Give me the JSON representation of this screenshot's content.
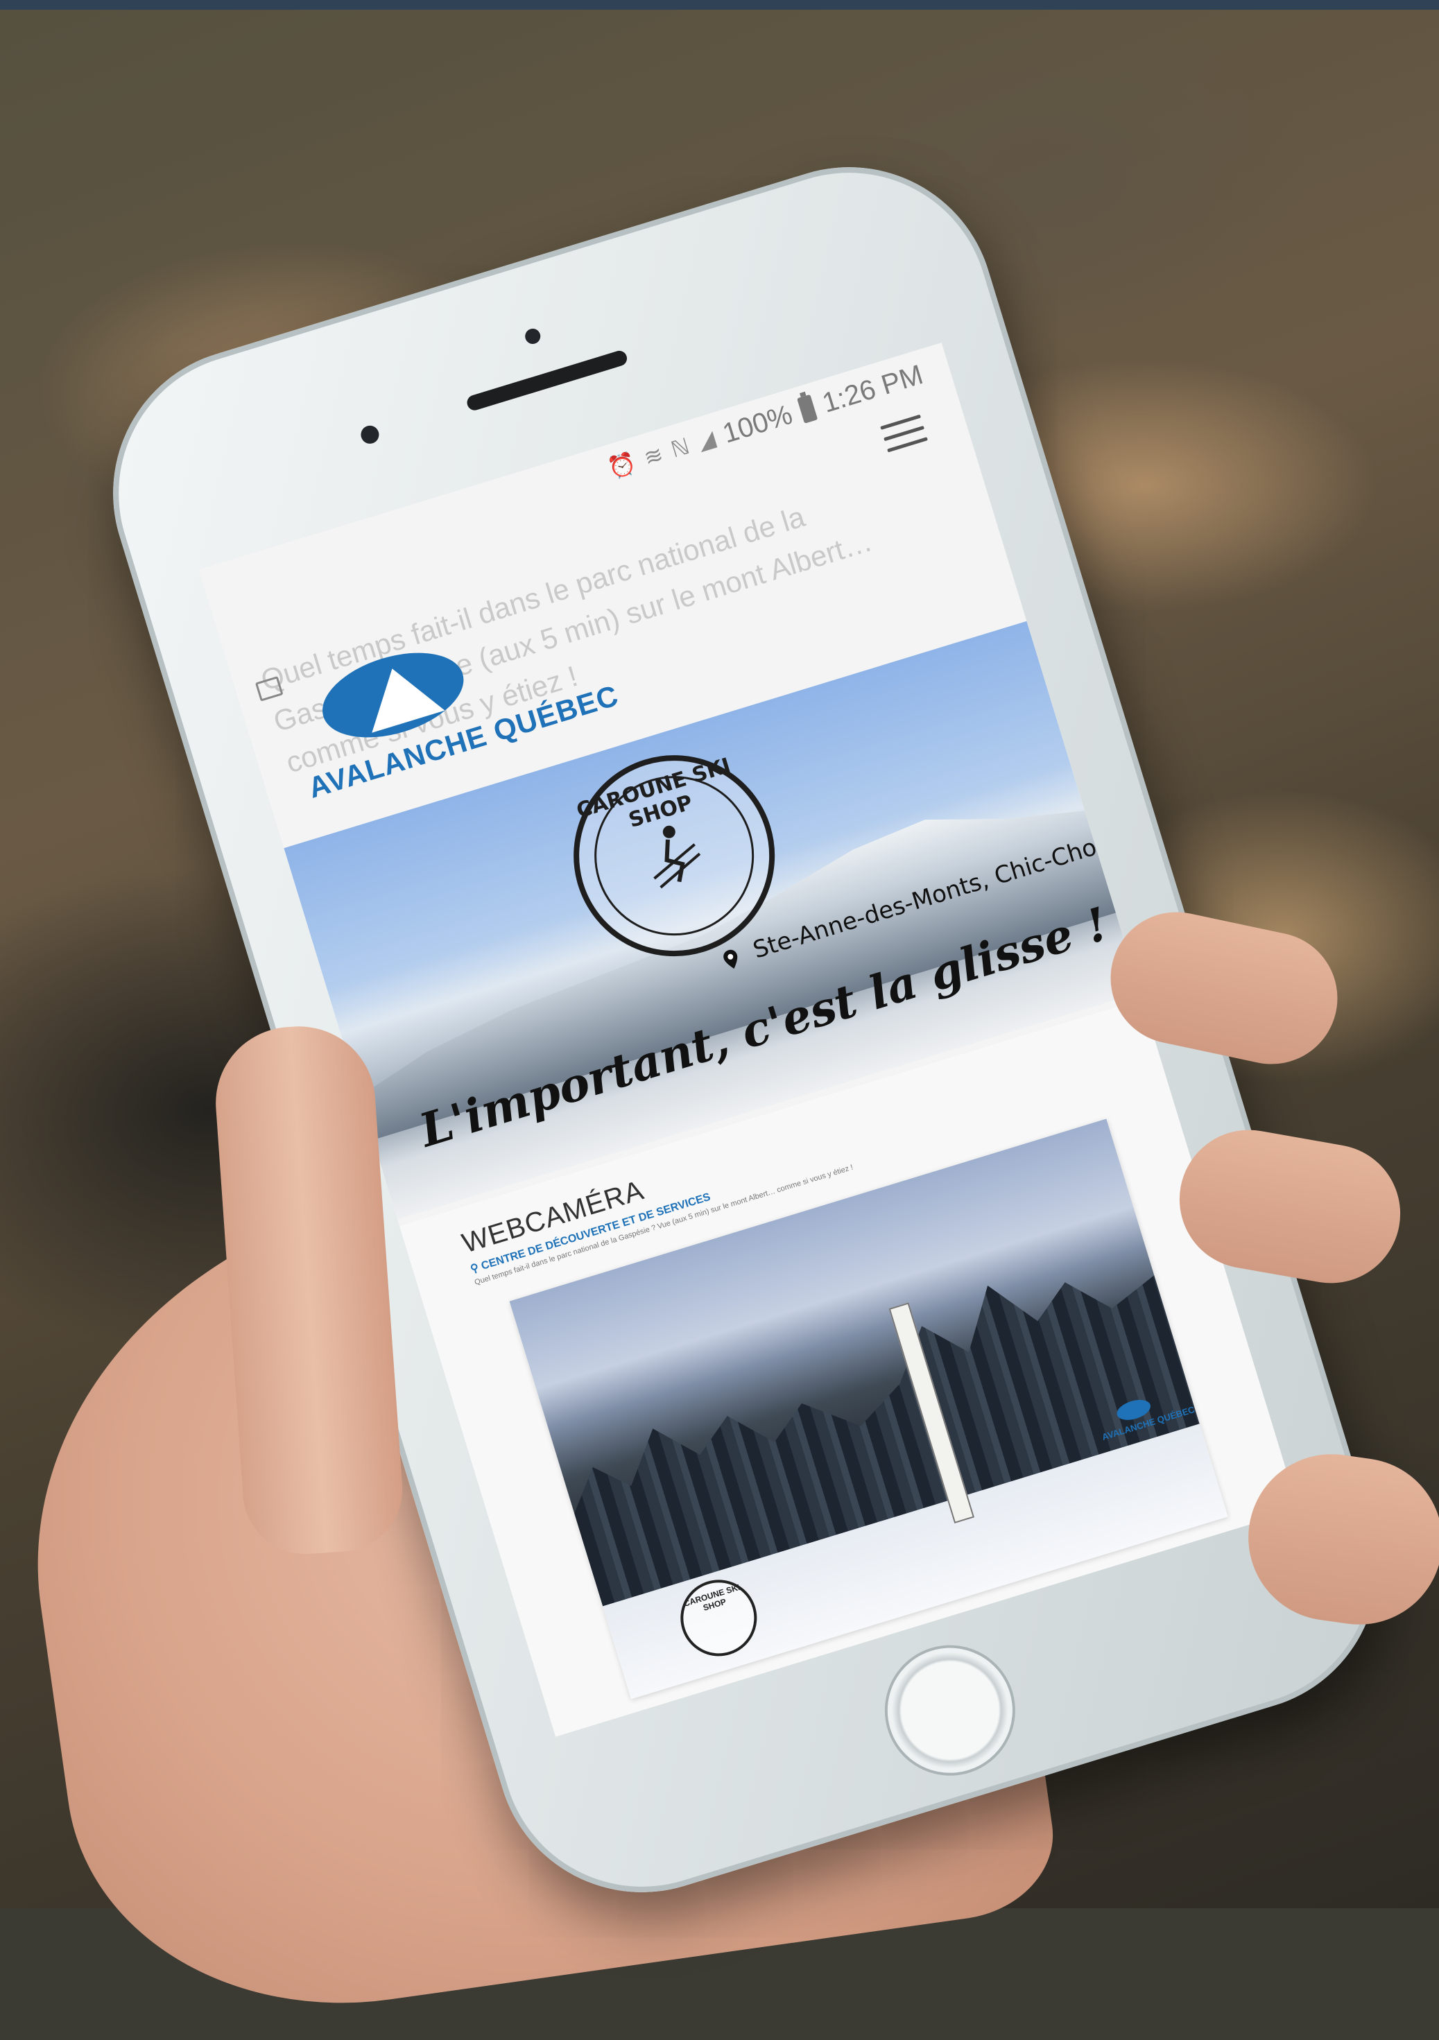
{
  "status_bar": {
    "battery_percent": "100%",
    "time": "1:26 PM",
    "icons": [
      "alarm-icon",
      "wifi-icon",
      "nfc-icon",
      "signal-icon",
      "battery-icon"
    ]
  },
  "header": {
    "menu_icon": "hamburger-menu-icon",
    "ghost_text": "Quel temps fait-il dans le parc national de la Gaspésie ? Vue (aux 5 min) sur le mont Albert… comme si vous y étiez !"
  },
  "logo": {
    "name": "AVALANCHE QUÉBEC",
    "color": "#1f72b8"
  },
  "hero": {
    "shop_name": "CAROUNE SKI SHOP",
    "tagline": "L'important, c'est la glisse !",
    "location": "Ste-Anne-des-Monts, Chic-Chocs"
  },
  "webcam": {
    "title": "WEBCAMÉRA",
    "subtitle": "CENTRE DE DÉCOUVERTE ET DE SERVICES",
    "description": "Quel temps fait-il dans le parc national de la Gaspésie ? Vue (aux 5 min) sur le mont Albert… comme si vous y étiez !",
    "watermark_logo": "AVALANCHE QUÉBEC",
    "watermark_shop": "CAROUNE SKI SHOP"
  }
}
